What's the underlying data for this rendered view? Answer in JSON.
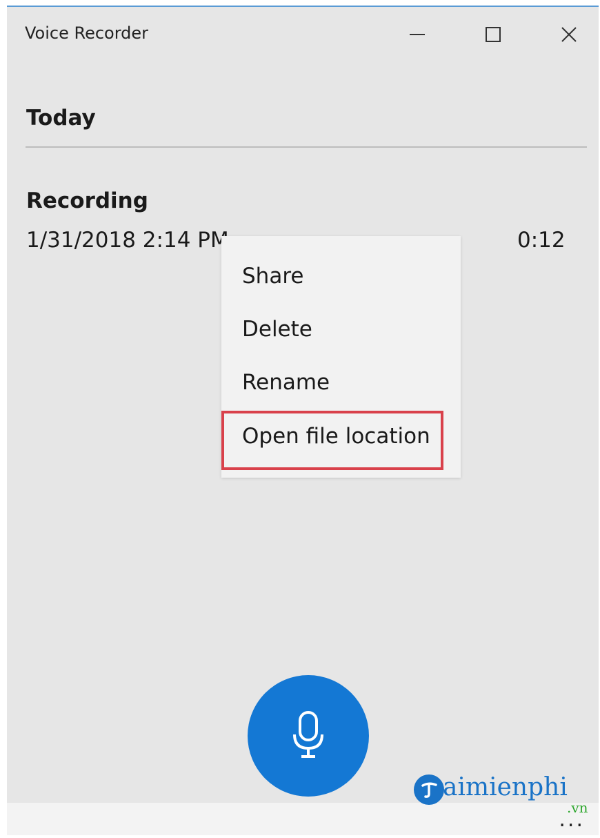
{
  "window": {
    "title": "Voice Recorder",
    "controls": {
      "minimize_icon": "minimize-icon",
      "maximize_icon": "maximize-icon",
      "close_icon": "close-icon"
    }
  },
  "list": {
    "group_header": "Today",
    "recordings": [
      {
        "name": "Recording",
        "date": "1/31/2018 2:14 PM",
        "duration": "0:12"
      }
    ]
  },
  "context_menu": {
    "items": [
      {
        "label": "Share"
      },
      {
        "label": "Delete"
      },
      {
        "label": "Rename"
      },
      {
        "label": "Open file location",
        "highlighted": true
      }
    ],
    "highlight_color": "#d9414b"
  },
  "record_button": {
    "icon": "microphone-icon",
    "color": "#1478d4"
  },
  "bottom_bar": {
    "more_label": "..."
  },
  "watermark": {
    "text": "aimienphi",
    "suffix": ".vn"
  }
}
